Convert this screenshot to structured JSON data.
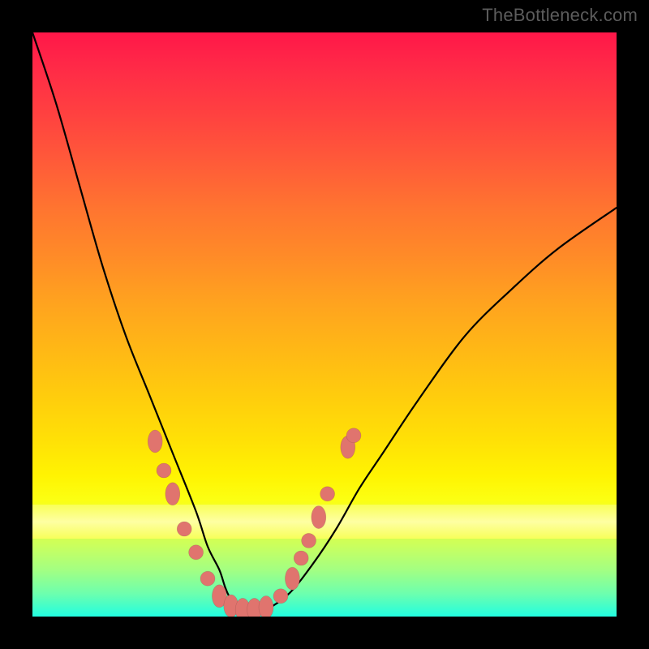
{
  "watermark": {
    "text": "TheBottleneck.com"
  },
  "chart_data": {
    "type": "line",
    "title": "",
    "xlabel": "",
    "ylabel": "",
    "xlim": [
      0,
      100
    ],
    "ylim": [
      0,
      100
    ],
    "grid": false,
    "annotations": [
      "TheBottleneck.com"
    ],
    "series": [
      {
        "name": "bottleneck-curve",
        "x": [
          0,
          4,
          8,
          12,
          16,
          20,
          24,
          28,
          30,
          32,
          33,
          34,
          36,
          38,
          40,
          44,
          48,
          52,
          56,
          60,
          66,
          74,
          82,
          90,
          100
        ],
        "y": [
          100,
          88,
          74,
          60,
          48,
          38,
          28,
          18,
          12,
          8,
          5,
          3,
          1.5,
          1,
          1.2,
          4,
          9,
          15,
          22,
          28,
          37,
          48,
          56,
          63,
          70
        ]
      }
    ],
    "markers": {
      "name": "highlight-points",
      "color": "#e0746e",
      "points": [
        {
          "x": 21,
          "y": 30,
          "shape": "tall"
        },
        {
          "x": 22.5,
          "y": 25,
          "shape": "round"
        },
        {
          "x": 24,
          "y": 21,
          "shape": "tall"
        },
        {
          "x": 26,
          "y": 15,
          "shape": "round"
        },
        {
          "x": 28,
          "y": 11,
          "shape": "round"
        },
        {
          "x": 30,
          "y": 6.5,
          "shape": "round"
        },
        {
          "x": 32,
          "y": 3.5,
          "shape": "tall"
        },
        {
          "x": 34,
          "y": 1.8,
          "shape": "tall"
        },
        {
          "x": 36,
          "y": 1.2,
          "shape": "tall"
        },
        {
          "x": 38,
          "y": 1.2,
          "shape": "tall"
        },
        {
          "x": 40,
          "y": 1.6,
          "shape": "tall"
        },
        {
          "x": 42.5,
          "y": 3.5,
          "shape": "round"
        },
        {
          "x": 44.5,
          "y": 6.5,
          "shape": "tall"
        },
        {
          "x": 46,
          "y": 10,
          "shape": "round"
        },
        {
          "x": 47.3,
          "y": 13,
          "shape": "round"
        },
        {
          "x": 49,
          "y": 17,
          "shape": "tall"
        },
        {
          "x": 50.5,
          "y": 21,
          "shape": "round"
        },
        {
          "x": 54,
          "y": 29,
          "shape": "tall"
        },
        {
          "x": 55,
          "y": 31,
          "shape": "round"
        }
      ]
    },
    "background": {
      "type": "vertical-gradient",
      "stops": [
        {
          "pos": 0.0,
          "color": "#ff1749"
        },
        {
          "pos": 0.5,
          "color": "#ffb716"
        },
        {
          "pos": 0.78,
          "color": "#fff402"
        },
        {
          "pos": 1.0,
          "color": "#22fde0"
        }
      ],
      "bright_band": {
        "y_from": 13,
        "y_to": 19,
        "color": "#ffffa8"
      }
    }
  }
}
